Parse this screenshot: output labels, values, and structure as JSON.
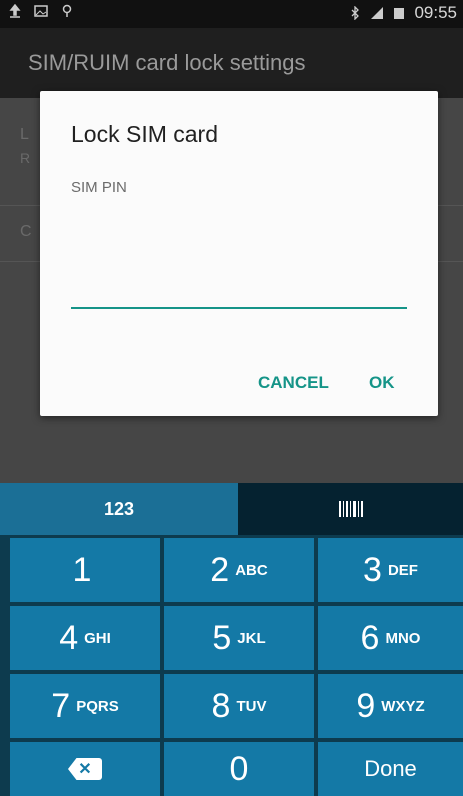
{
  "status_bar": {
    "time": "09:55"
  },
  "header": {
    "title": "SIM/RUIM card lock settings"
  },
  "background_rows": {
    "row1_initial": "L",
    "row1_sub_initial": "R",
    "row2_initial": "C"
  },
  "dialog": {
    "title": "Lock SIM card",
    "label": "SIM PIN",
    "input_value": "",
    "cancel": "CANCEL",
    "ok": "OK"
  },
  "keyboard": {
    "tab_numbers": "123",
    "tab_barcode_icon": "barcode-icon",
    "keys": [
      {
        "num": "1",
        "sub": ""
      },
      {
        "num": "2",
        "sub": "ABC"
      },
      {
        "num": "3",
        "sub": "DEF"
      },
      {
        "num": "4",
        "sub": "GHI"
      },
      {
        "num": "5",
        "sub": "JKL"
      },
      {
        "num": "6",
        "sub": "MNO"
      },
      {
        "num": "7",
        "sub": "PQRS"
      },
      {
        "num": "8",
        "sub": "TUV"
      },
      {
        "num": "9",
        "sub": "WXYZ"
      }
    ],
    "zero": "0",
    "done": "Done",
    "delete_icon": "backspace-icon"
  },
  "colors": {
    "accent": "#159488",
    "key_bg": "#1479a6",
    "tab_active": "#1b6f96"
  }
}
